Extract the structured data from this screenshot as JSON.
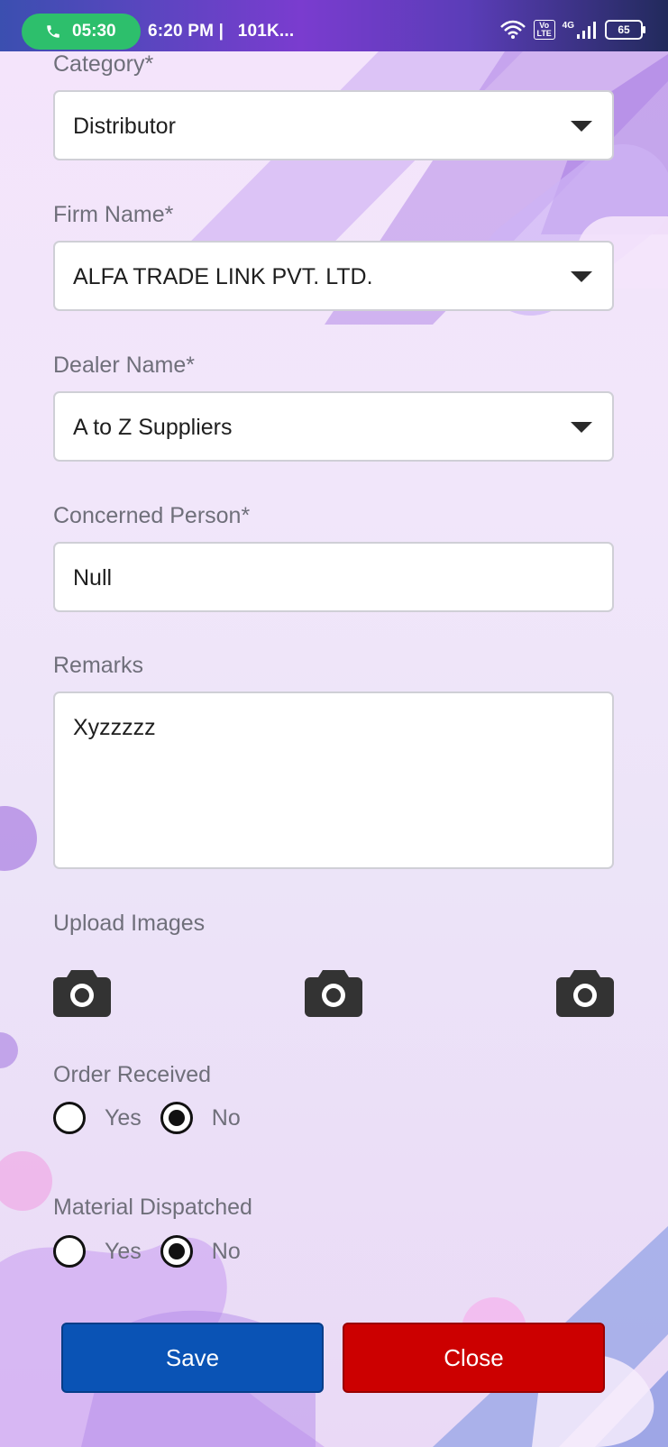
{
  "status_bar": {
    "call_time": "05:30",
    "time_text": "6:20 PM |",
    "notification_text": "101K...",
    "network_label": "4G",
    "volte_label": "Vo LTE",
    "battery": "65"
  },
  "form": {
    "category": {
      "label": "Category*",
      "value": "Distributor"
    },
    "firm_name": {
      "label": "Firm Name*",
      "value": "ALFA TRADE LINK PVT. LTD."
    },
    "dealer_name": {
      "label": "Dealer Name*",
      "value": "A to Z Suppliers"
    },
    "concerned_person": {
      "label": "Concerned Person*",
      "value": "Null"
    },
    "remarks": {
      "label": "Remarks",
      "value": "Xyzzzzz"
    },
    "upload_images": {
      "label": "Upload Images"
    },
    "order_received": {
      "label": "Order Received",
      "yes": "Yes",
      "no": "No",
      "selected": "No"
    },
    "material_dispatched": {
      "label": "Material Dispatched",
      "yes": "Yes",
      "no": "No",
      "selected": "No"
    }
  },
  "buttons": {
    "save": "Save",
    "close": "Close"
  },
  "colors": {
    "save_button": "#0a53b5",
    "close_button": "#cc0000",
    "call_pill": "#2dbf6c",
    "status_bar_accent": "#7a3ccf"
  }
}
